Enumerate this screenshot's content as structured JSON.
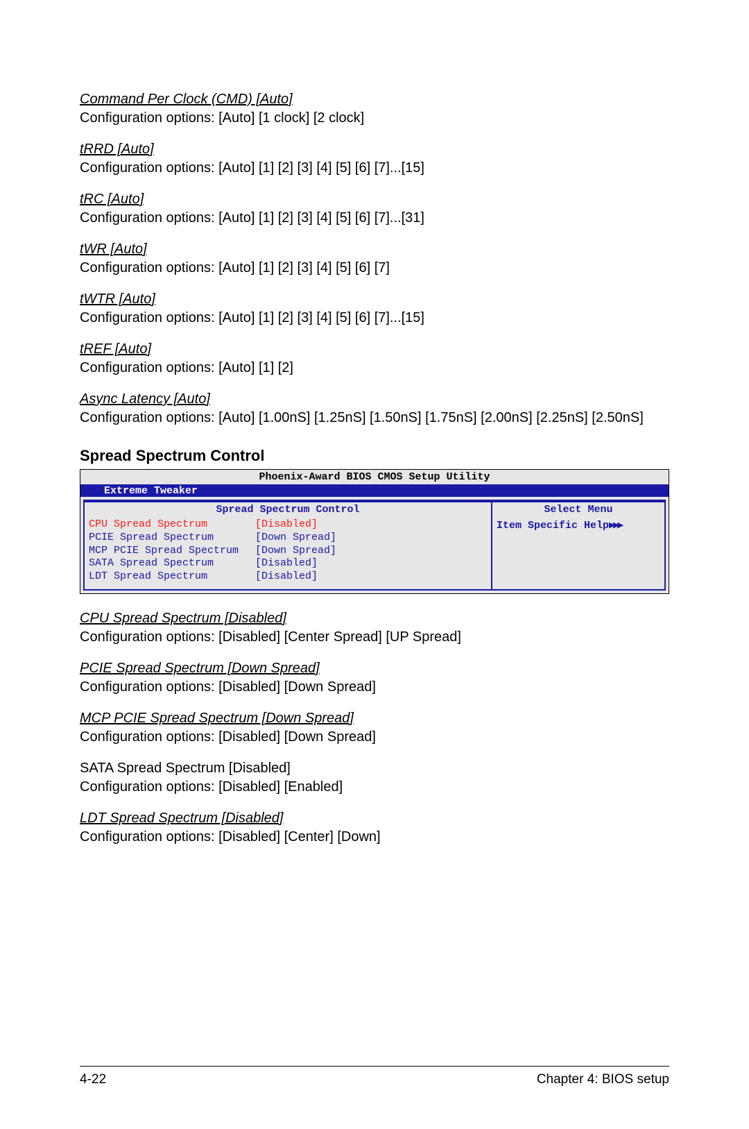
{
  "settings_top": [
    {
      "title": "Command Per Clock (CMD) [Auto]",
      "desc": "Configuration options: [Auto] [1 clock] [2 clock]"
    },
    {
      "title": "tRRD [Auto]",
      "desc": "Configuration options: [Auto] [1] [2] [3] [4] [5] [6] [7]...[15]"
    },
    {
      "title": "tRC [Auto]",
      "desc": "Configuration options: [Auto] [1] [2] [3] [4] [5] [6] [7]...[31]"
    },
    {
      "title": "tWR [Auto]",
      "desc": "Configuration options: [Auto] [1] [2] [3] [4] [5] [6] [7]"
    },
    {
      "title": "tWTR [Auto]",
      "desc": "Configuration options: [Auto] [1] [2] [3] [4] [5] [6] [7]...[15]"
    },
    {
      "title": "tREF [Auto]",
      "desc": "Configuration options: [Auto] [1] [2]"
    },
    {
      "title": "Async Latency [Auto]",
      "desc": "Configuration options: [Auto] [1.00nS] [1.25nS] [1.50nS] [1.75nS] [2.00nS] [2.25nS] [2.50nS]"
    }
  ],
  "section_heading": "Spread Spectrum Control",
  "bios": {
    "utility_title": "Phoenix-Award BIOS CMOS Setup Utility",
    "tab": "Extreme Tweaker",
    "left_heading": "Spread Spectrum Control",
    "right_heading": "Select Menu",
    "help_label": "Item Specific Help",
    "help_arrows": "▶▶▶",
    "rows": [
      {
        "label": "CPU Spread Spectrum",
        "value": "[Disabled]",
        "selected": true
      },
      {
        "label": "PCIE Spread Spectrum",
        "value": "[Down Spread]",
        "selected": false
      },
      {
        "label": "MCP PCIE Spread Spectrum",
        "value": "[Down Spread]",
        "selected": false
      },
      {
        "label": "SATA Spread Spectrum",
        "value": "[Disabled]",
        "selected": false
      },
      {
        "label": "LDT Spread Spectrum",
        "value": "[Disabled]",
        "selected": false
      }
    ]
  },
  "settings_bottom": [
    {
      "title": "CPU Spread Spectrum [Disabled]",
      "plain": false,
      "desc": "Configuration options: [Disabled] [Center Spread] [UP Spread]"
    },
    {
      "title": "PCIE Spread Spectrum [Down Spread] ",
      "plain": false,
      "desc": "Configuration options: [Disabled] [Down Spread]"
    },
    {
      "title": "MCP PCIE Spread Spectrum [Down Spread] ",
      "plain": false,
      "desc": "Configuration options: [Disabled] [Down Spread]"
    },
    {
      "title": "SATA Spread Spectrum [Disabled]",
      "plain": true,
      "desc": "Configuration options: [Disabled] [Enabled]"
    },
    {
      "title": "LDT Spread Spectrum [Disabled]",
      "plain": false,
      "desc": "Configuration options: [Disabled] [Center] [Down]"
    }
  ],
  "footer": {
    "left": "4-22",
    "right": "Chapter 4: BIOS setup"
  }
}
